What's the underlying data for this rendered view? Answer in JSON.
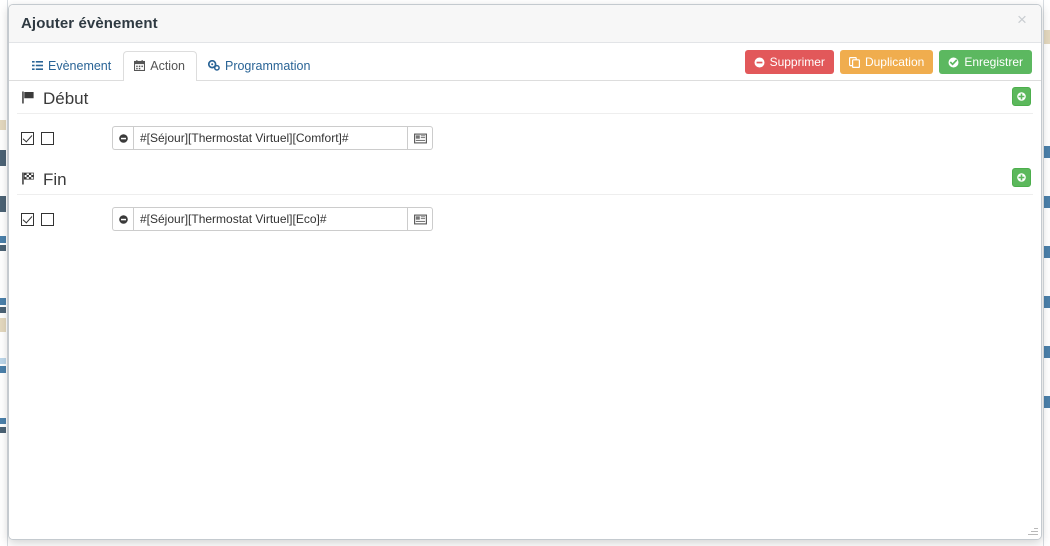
{
  "modal": {
    "title": "Ajouter évènement",
    "close_label": "×"
  },
  "tabs": [
    {
      "label": "Evènement",
      "icon": "list-icon",
      "active": false
    },
    {
      "label": "Action",
      "icon": "calendar-icon",
      "active": true
    },
    {
      "label": "Programmation",
      "icon": "gears-icon",
      "active": false
    }
  ],
  "header_actions": [
    {
      "label": "Supprimer",
      "icon": "minus-circle-icon",
      "style": "danger",
      "color": "#e2585a"
    },
    {
      "label": "Duplication",
      "icon": "copy-icon",
      "style": "warning",
      "color": "#f0ad4e"
    },
    {
      "label": "Enregistrer",
      "icon": "check-circle-icon",
      "style": "success",
      "color": "#5cb860"
    }
  ],
  "sections": [
    {
      "title": "Début",
      "flag_icon": "flag-icon",
      "add_button_label": "+",
      "rows": [
        {
          "checkbox_enabled": true,
          "checkbox_secondary": false,
          "remove_icon": "minus-circle-icon",
          "value": "#[Séjour][Thermostat Virtuel][Comfort]#",
          "placeholder": "",
          "picker_icon": "list-window-icon"
        }
      ]
    },
    {
      "title": "Fin",
      "flag_icon": "flag-checkered-icon",
      "add_button_label": "+",
      "rows": [
        {
          "checkbox_enabled": true,
          "checkbox_secondary": false,
          "remove_icon": "minus-circle-icon",
          "value": "#[Séjour][Thermostat Virtuel][Eco]#",
          "placeholder": "",
          "picker_icon": "list-window-icon"
        }
      ]
    }
  ],
  "colors": {
    "accent_link": "#2a6496",
    "success": "#5cb85c",
    "danger": "#e2585a",
    "warning": "#f0ad4e",
    "header_bg": "#f7f7f7"
  }
}
